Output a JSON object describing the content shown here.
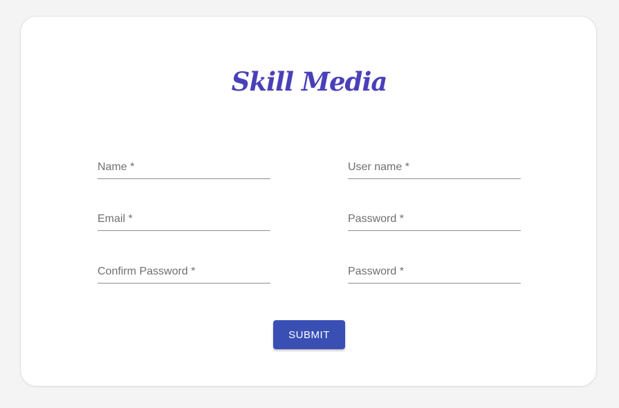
{
  "brand": {
    "title": "Skill Media",
    "color": "#4a40b8"
  },
  "form": {
    "fields": [
      {
        "label": "Name *",
        "value": ""
      },
      {
        "label": "User name *",
        "value": ""
      },
      {
        "label": "Email *",
        "value": ""
      },
      {
        "label": "Password *",
        "value": ""
      },
      {
        "label": "Confirm Password *",
        "value": ""
      },
      {
        "label": "Password *",
        "value": ""
      }
    ],
    "submit_label": "SUBMIT",
    "submit_color": "#3a4fb4"
  }
}
